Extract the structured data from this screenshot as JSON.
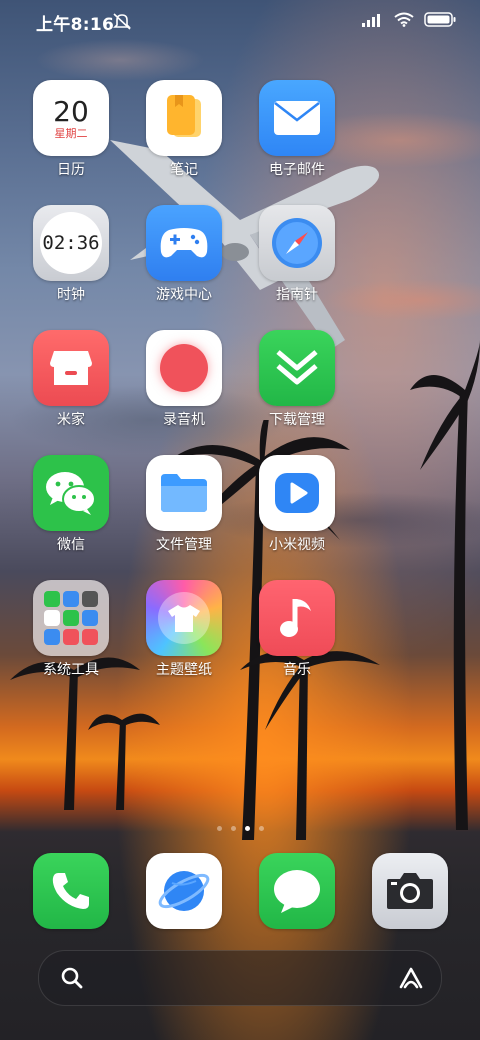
{
  "status_bar": {
    "time": "上午8:16",
    "icons": [
      "alarm-off-icon",
      "signal-icon",
      "wifi-icon",
      "battery-icon"
    ]
  },
  "calendar": {
    "day": "20",
    "weekday": "星期二"
  },
  "clock": {
    "time": "02:36"
  },
  "apps": {
    "calendar": "日历",
    "notes": "笔记",
    "email": "电子邮件",
    "clock": "时钟",
    "game_center": "游戏中心",
    "compass": "指南针",
    "mijia": "米家",
    "recorder": "录音机",
    "downloads": "下载管理",
    "wechat": "微信",
    "file_manager": "文件管理",
    "mi_video": "小米视频",
    "system_tools": "系统工具",
    "themes": "主题壁纸",
    "music": "音乐"
  },
  "dock": [
    "phone-icon",
    "browser-icon",
    "messages-icon",
    "camera-icon"
  ],
  "pagination": {
    "total": 3,
    "active": 2
  },
  "search": {
    "left_icon": "search-icon",
    "right_icon": "assistant-icon"
  },
  "colors": {
    "wechat": "#2DC24A",
    "downloads": "#2DC24A",
    "music": "#F0525B",
    "mijia": "#F0525B"
  }
}
